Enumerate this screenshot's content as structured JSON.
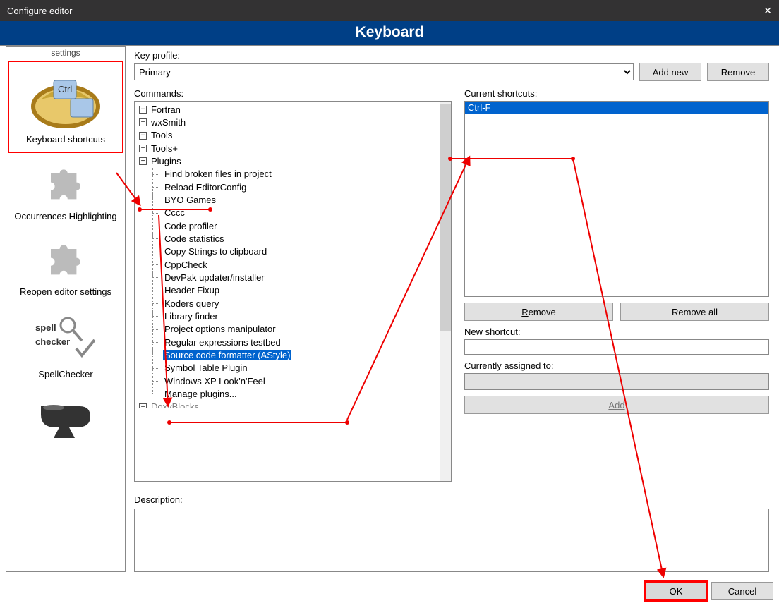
{
  "titlebar": {
    "title": "Configure editor"
  },
  "banner": "Keyboard",
  "sidebar": {
    "top_label": "settings",
    "items": [
      {
        "label": "Keyboard shortcuts",
        "selected": true,
        "icon": "ring"
      },
      {
        "label": "Occurrences Highlighting",
        "icon": "puzzle"
      },
      {
        "label": "Reopen editor settings",
        "icon": "puzzle"
      },
      {
        "label": "SpellChecker",
        "icon": "spell"
      },
      {
        "label": "",
        "icon": "anvil"
      }
    ]
  },
  "keyprofile": {
    "label": "Key profile:",
    "value": "Primary",
    "add": "Add new",
    "remove": "Remove"
  },
  "commands": {
    "label": "Commands:",
    "nodes": [
      {
        "label": "Fortran",
        "expandable": true,
        "expanded": false
      },
      {
        "label": "wxSmith",
        "expandable": true,
        "expanded": false
      },
      {
        "label": "Tools",
        "expandable": true,
        "expanded": false
      },
      {
        "label": "Tools+",
        "expandable": true,
        "expanded": false
      },
      {
        "label": "Plugins",
        "expandable": true,
        "expanded": true,
        "children": [
          "Find broken files in project",
          "Reload EditorConfig",
          "BYO Games",
          "Cccc",
          "Code profiler",
          "Code statistics",
          "Copy Strings to clipboard",
          "CppCheck",
          "DevPak updater/installer",
          "Header Fixup",
          "Koders query",
          "Library finder",
          "Project options manipulator",
          "Regular expressions testbed",
          "Source code formatter (AStyle)",
          "Symbol Table Plugin",
          "Windows XP Look'n'Feel",
          "Manage plugins..."
        ],
        "selected_child": "Source code formatter (AStyle)"
      },
      {
        "label": "DoxyBlocks",
        "expandable": true,
        "expanded": false,
        "cut": true
      }
    ]
  },
  "current": {
    "label": "Current shortcuts:",
    "items": [
      "Ctrl-F"
    ],
    "remove": "Remove",
    "removeall": "Remove all"
  },
  "newshortcut": {
    "label": "New shortcut:",
    "value": ""
  },
  "assigned": {
    "label": "Currently assigned to:",
    "add": "Add"
  },
  "description": {
    "label": "Description:"
  },
  "footer": {
    "ok": "OK",
    "cancel": "Cancel"
  }
}
